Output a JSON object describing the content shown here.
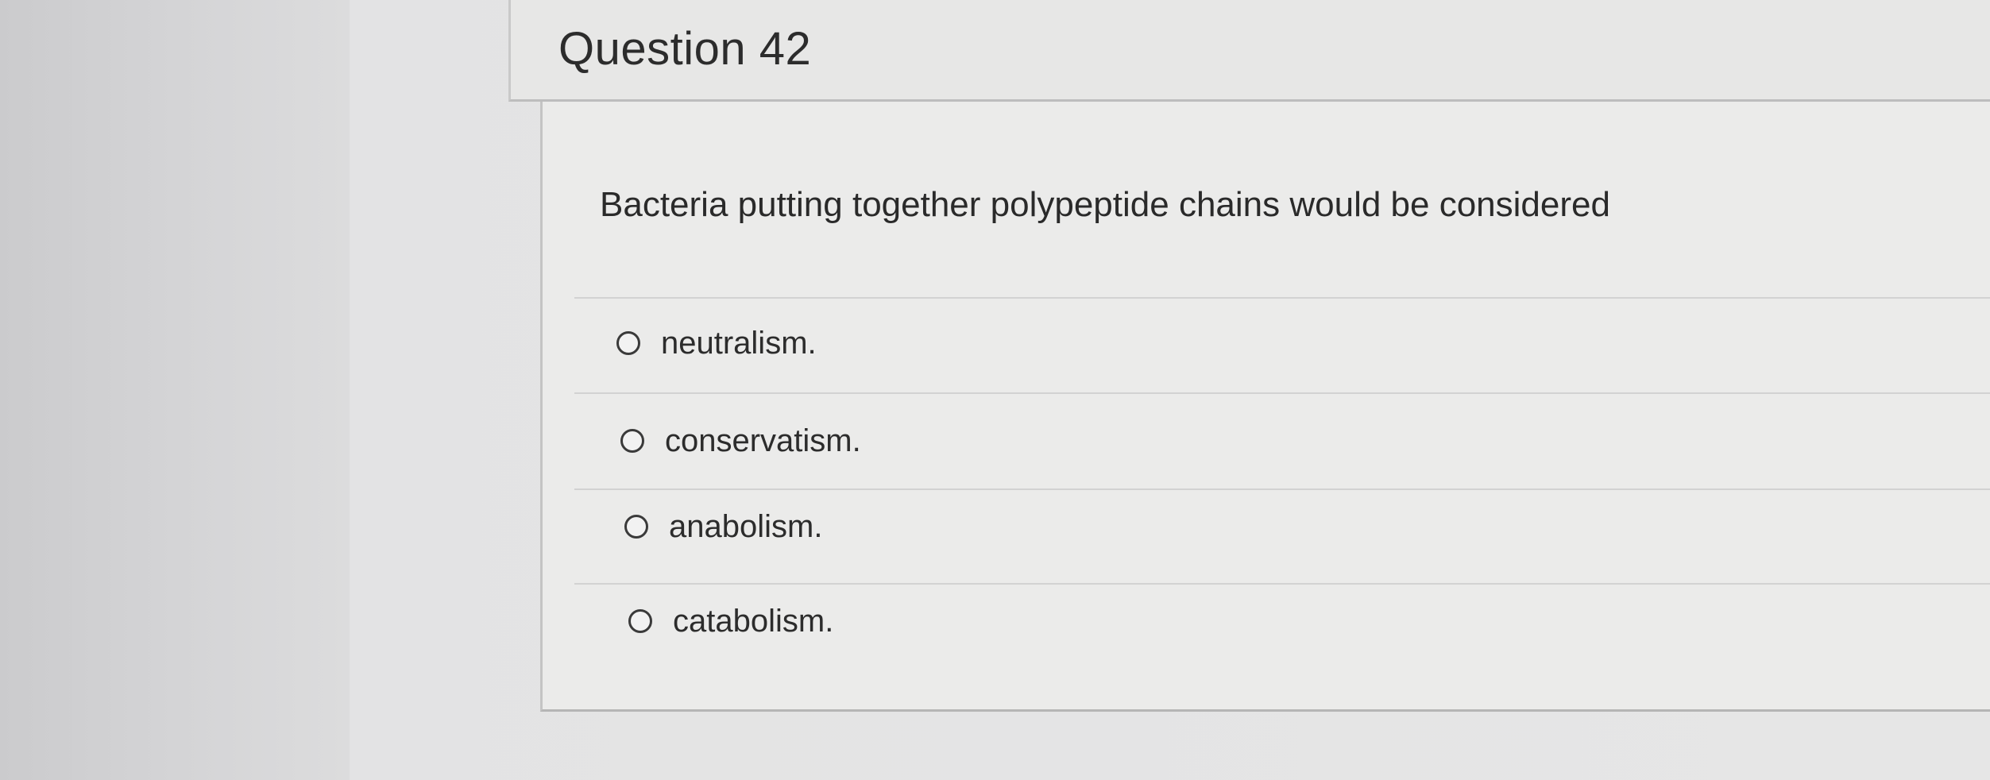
{
  "question": {
    "title": "Question 42",
    "text": "Bacteria putting together polypeptide chains would be considered",
    "options": [
      {
        "label": "neutralism."
      },
      {
        "label": "conservatism."
      },
      {
        "label": "anabolism."
      },
      {
        "label": "catabolism."
      }
    ]
  }
}
